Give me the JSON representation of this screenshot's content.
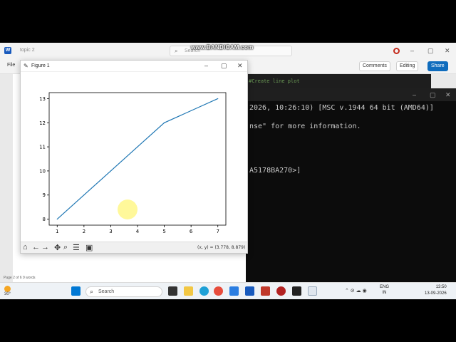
{
  "recorder_watermark": "www.BANDICAM.com",
  "word": {
    "doc_name": "topic 2",
    "search_placeholder": "Search",
    "menu_file": "File",
    "comments_label": "Comments",
    "editing_label": "Editing",
    "share_label": "Share",
    "status": "Page 2 of 6   9 words"
  },
  "editor": {
    "code_comment": "#Create line plot"
  },
  "terminal": {
    "lines": [
      "2026, 10:26:10) [MSC v.1944 64 bit (AMD64)]",
      "nse\" for more information.",
      "A5178BA270>]"
    ]
  },
  "figure": {
    "title": "Figure 1",
    "coord_readout": "(x, y) = (3.778, 8.879)"
  },
  "chart_data": {
    "type": "line",
    "x": [
      1,
      2,
      3,
      4,
      5,
      6,
      7
    ],
    "y": [
      8,
      9,
      10,
      11,
      12,
      12.5,
      13
    ],
    "xticks": [
      "1",
      "2",
      "3",
      "4",
      "5",
      "6",
      "7"
    ],
    "yticks": [
      "8",
      "9",
      "10",
      "11",
      "12",
      "13"
    ],
    "xlim": [
      0.7,
      7.3
    ],
    "ylim": [
      7.75,
      13.25
    ],
    "line_color": "#1f77b4",
    "grid": false
  },
  "taskbar": {
    "temperature": "30°",
    "search_placeholder": "Search",
    "lang_top": "ENG",
    "lang_bottom": "IN",
    "time": "13:50",
    "date": "13-09-2026"
  },
  "colors": {
    "taskbar_bg": "#eef2f6",
    "terminal_bg": "#0c0c0c",
    "share_blue": "#0f6cbd"
  }
}
